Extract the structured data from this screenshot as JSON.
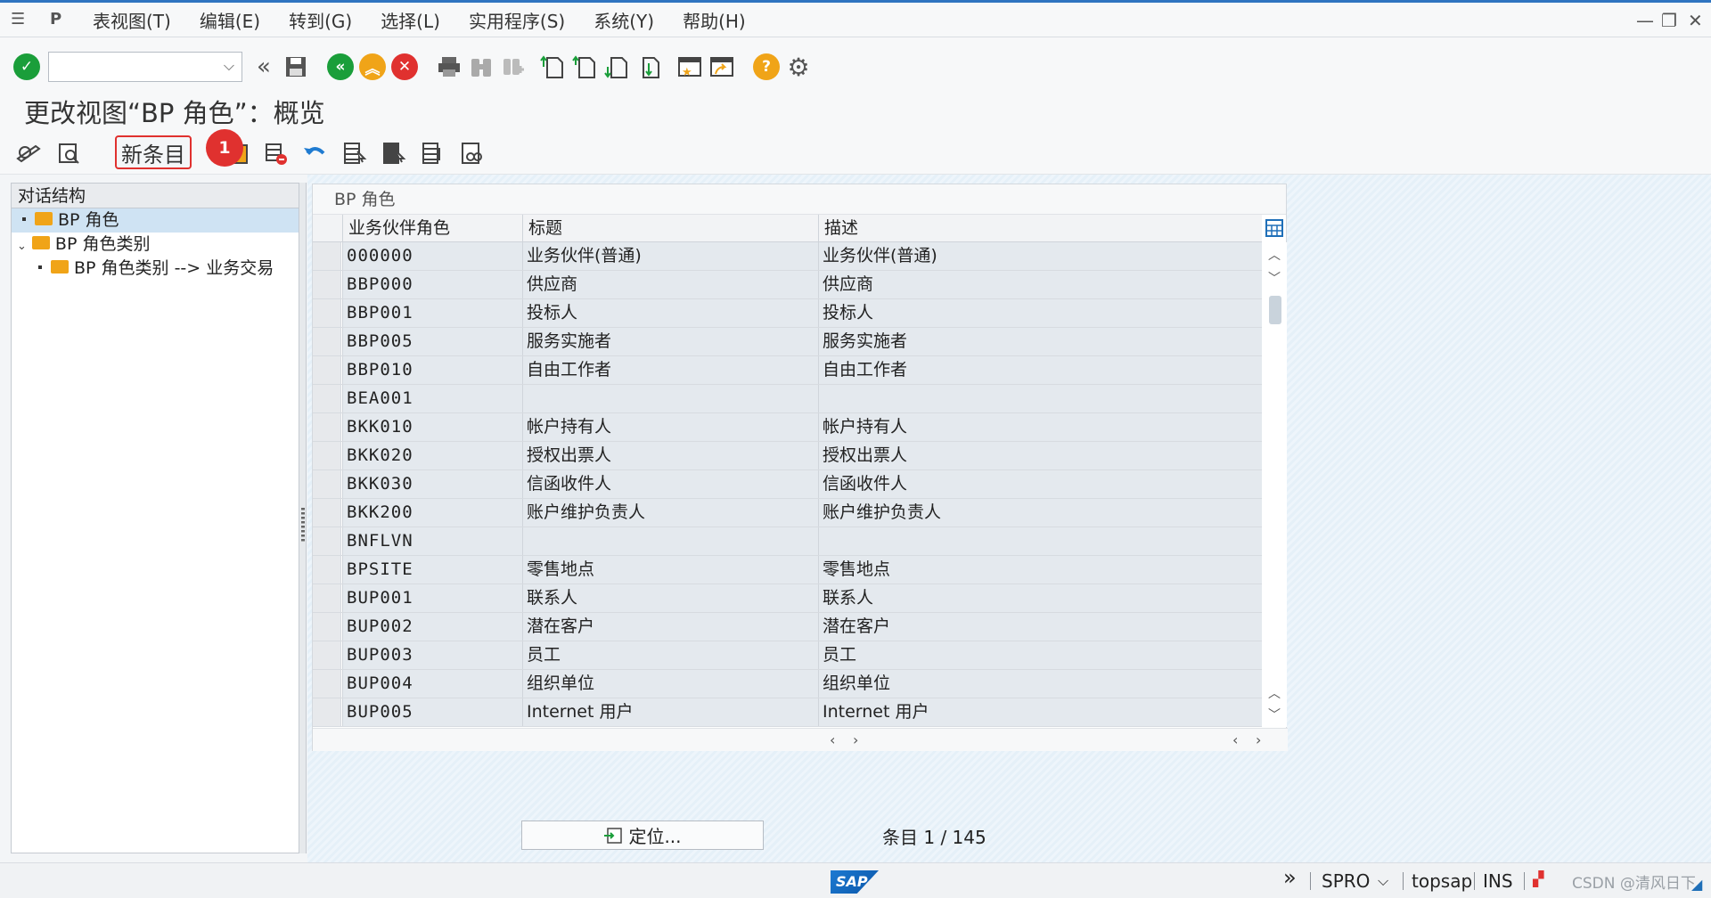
{
  "menu": {
    "items": [
      "表视图(T)",
      "编辑(E)",
      "转到(G)",
      "选择(L)",
      "实用程序(S)",
      "系统(Y)",
      "帮助(H)"
    ]
  },
  "toolbar": {
    "command_field_value": ""
  },
  "title": "更改视图“BP 角色”：概览",
  "app_toolbar": {
    "new_entries_label": "新条目",
    "badge_number": "1"
  },
  "tree": {
    "header": "对话结构",
    "items": [
      {
        "label": "BP 角色",
        "level": 1,
        "selected": true
      },
      {
        "label": "BP 角色类别",
        "level": 1,
        "expanded": true
      },
      {
        "label": "BP 角色类别 --> 业务交易",
        "level": 2
      }
    ]
  },
  "table": {
    "title": "BP 角色",
    "columns": [
      "业务伙伴角色",
      "标题",
      "描述"
    ],
    "rows": [
      {
        "code": "000000",
        "title": "业务伙伴(普通)",
        "desc": "业务伙伴(普通)"
      },
      {
        "code": "BBP000",
        "title": "供应商",
        "desc": "供应商"
      },
      {
        "code": "BBP001",
        "title": "投标人",
        "desc": "投标人"
      },
      {
        "code": "BBP005",
        "title": "服务实施者",
        "desc": "服务实施者"
      },
      {
        "code": "BBP010",
        "title": "自由工作者",
        "desc": "自由工作者"
      },
      {
        "code": "BEA001",
        "title": "",
        "desc": ""
      },
      {
        "code": "BKK010",
        "title": "帐户持有人",
        "desc": "帐户持有人"
      },
      {
        "code": "BKK020",
        "title": "授权出票人",
        "desc": "授权出票人"
      },
      {
        "code": "BKK030",
        "title": "信函收件人",
        "desc": "信函收件人"
      },
      {
        "code": "BKK200",
        "title": "账户维护负责人",
        "desc": "账户维护负责人"
      },
      {
        "code": "BNFLVN",
        "title": "",
        "desc": ""
      },
      {
        "code": "BPSITE",
        "title": "零售地点",
        "desc": "零售地点"
      },
      {
        "code": "BUP001",
        "title": "联系人",
        "desc": "联系人"
      },
      {
        "code": "BUP002",
        "title": "潜在客户",
        "desc": "潜在客户"
      },
      {
        "code": "BUP003",
        "title": "员工",
        "desc": "员工"
      },
      {
        "code": "BUP004",
        "title": "组织单位",
        "desc": "组织单位"
      },
      {
        "code": "BUP005",
        "title": "Internet 用户",
        "desc": "Internet 用户"
      }
    ]
  },
  "footer": {
    "position_button": "定位...",
    "entry_count": "条目 1 / 145"
  },
  "statusbar": {
    "logo": "SAP",
    "transaction": "SPRO",
    "server": "topsap",
    "mode": "INS",
    "watermark": "CSDN @清风日下"
  },
  "colors": {
    "accent_blue": "#2f74c0",
    "highlight_red": "#e0312f",
    "folder_orange": "#f0a418",
    "selected_row": "#cfe3f3"
  }
}
